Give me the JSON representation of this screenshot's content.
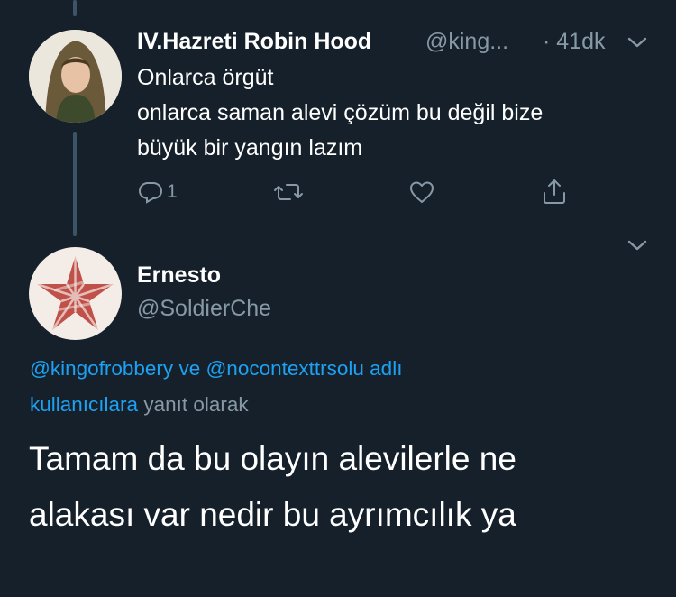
{
  "parent_tweet": {
    "display_name": "IV.Hazreti Robin Hood",
    "handle": "@king...",
    "time": "· 41dk",
    "text_lines": [
      "Onlarca örgüt",
      "onlarca saman alevi çözüm bu değil bize",
      "büyük bir yangın lazım"
    ],
    "actions": {
      "reply_count": "1"
    }
  },
  "main_tweet": {
    "display_name": "Ernesto",
    "handle": "@SoldierChe",
    "reply_to": {
      "user1": "@kingofrobbery",
      "connector": "ve",
      "user2": "@nocontexttrsolu",
      "suffix_link": "adlı kullanıcılara",
      "suffix_text": "yanıt olarak"
    },
    "text_lines": [
      "Tamam da bu olayın alevilerle ne",
      "alakası var nedir bu ayrımcılık ya"
    ]
  },
  "colors": {
    "background": "#15202b",
    "text": "#ffffff",
    "muted": "#8899a6",
    "link": "#1da1f2",
    "thread_line": "#3d5466"
  },
  "icons": [
    "chevron-down-icon",
    "reply-icon",
    "retweet-icon",
    "like-icon",
    "share-icon"
  ]
}
